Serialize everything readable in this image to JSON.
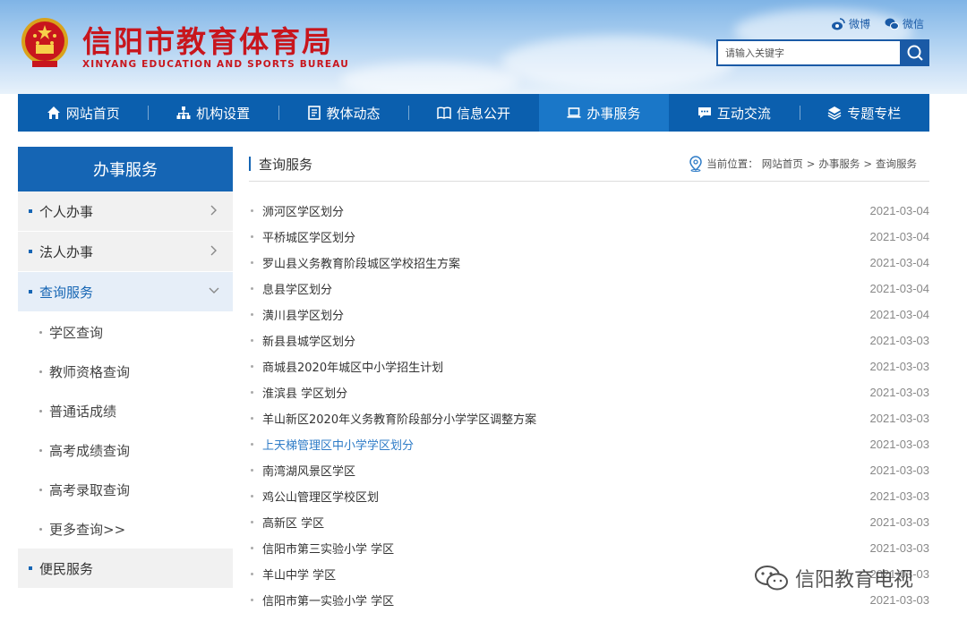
{
  "header": {
    "title": "信阳市教育体育局",
    "subtitle": "XINYANG EDUCATION AND SPORTS BUREAU",
    "social": [
      {
        "label": "微博",
        "icon": "weibo-icon"
      },
      {
        "label": "微信",
        "icon": "wechat-icon"
      }
    ],
    "search": {
      "placeholder": "请输入关键字",
      "icon": "search-icon"
    }
  },
  "nav": {
    "items": [
      {
        "label": "网站首页",
        "icon": "home-icon"
      },
      {
        "label": "机构设置",
        "icon": "org-chart-icon"
      },
      {
        "label": "教体动态",
        "icon": "document-icon"
      },
      {
        "label": "信息公开",
        "icon": "book-icon"
      },
      {
        "label": "办事服务",
        "icon": "laptop-icon",
        "active": true
      },
      {
        "label": "互动交流",
        "icon": "chat-icon"
      },
      {
        "label": "专题专栏",
        "icon": "layers-icon"
      }
    ]
  },
  "sidebar": {
    "title": "办事服务",
    "items": [
      {
        "label": "个人办事"
      },
      {
        "label": "法人办事"
      },
      {
        "label": "查询服务",
        "active": true
      }
    ],
    "subitems": [
      {
        "label": "学区查询"
      },
      {
        "label": "教师资格查询"
      },
      {
        "label": "普通话成绩"
      },
      {
        "label": "高考成绩查询"
      },
      {
        "label": "高考录取查询"
      },
      {
        "label": "更多查询>>"
      }
    ],
    "bottom_item": {
      "label": "便民服务"
    }
  },
  "main": {
    "title": "查询服务",
    "breadcrumb": {
      "prefix": "当前位置：",
      "items": [
        "网站首页",
        "办事服务",
        "查询服务"
      ],
      "sep": ">"
    },
    "list": [
      {
        "title": "浉河区学区划分",
        "date": "2021-03-04"
      },
      {
        "title": "平桥城区学区划分",
        "date": "2021-03-04"
      },
      {
        "title": "罗山县义务教育阶段城区学校招生方案",
        "date": "2021-03-04"
      },
      {
        "title": "息县学区划分",
        "date": "2021-03-04"
      },
      {
        "title": "潢川县学区划分",
        "date": "2021-03-04"
      },
      {
        "title": "新县县城学区划分",
        "date": "2021-03-03"
      },
      {
        "title": "商城县2020年城区中小学招生计划",
        "date": "2021-03-03"
      },
      {
        "title": "淮滨县 学区划分",
        "date": "2021-03-03"
      },
      {
        "title": "羊山新区2020年义务教育阶段部分小学学区调整方案",
        "date": "2021-03-03"
      },
      {
        "title": "上天梯管理区中小学学区划分",
        "date": "2021-03-03",
        "highlight": true
      },
      {
        "title": "南湾湖风景区学区",
        "date": "2021-03-03"
      },
      {
        "title": "鸡公山管理区学校区划",
        "date": "2021-03-03"
      },
      {
        "title": "高新区 学区",
        "date": "2021-03-03"
      },
      {
        "title": "信阳市第三实验小学 学区",
        "date": "2021-03-03"
      },
      {
        "title": "羊山中学 学区",
        "date": "2021-03-03"
      },
      {
        "title": "信阳市第一实验小学 学区",
        "date": "2021-03-03"
      }
    ]
  },
  "watermark": {
    "label": "信阳教育电视"
  },
  "colors": {
    "brand_red": "#c8161d",
    "nav_blue": "#0b5fae",
    "active_blue": "#1a77c8",
    "link_blue": "#2f7cc7"
  }
}
